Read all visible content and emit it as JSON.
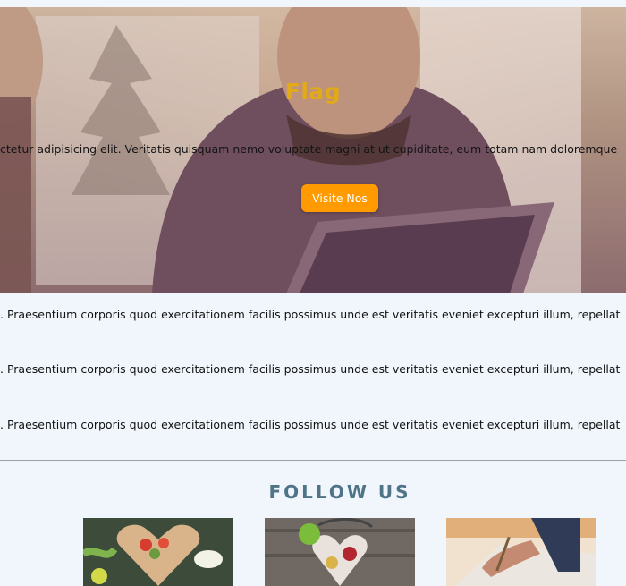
{
  "hero": {
    "title": "Flag",
    "subtitle": "ctetur adipisicing elit. Veritatis quisquam nemo voluptate magni at ut cupiditate, eum totam nam doloremque",
    "button_label": "Visite Nos"
  },
  "text_lines": [
    ". Praesentium corporis quod exercitationem facilis possimus unde est veritatis eveniet excepturi illum, repellat",
    ". Praesentium corporis quod exercitationem facilis possimus unde est veritatis eveniet excepturi illum, repellat",
    ". Praesentium corporis quod exercitationem facilis possimus unde est veritatis eveniet excepturi illum, repellat"
  ],
  "follow": {
    "title": "FOLLOW US",
    "images": [
      {
        "label": "salad-heart-image"
      },
      {
        "label": "stethoscope-heart-image"
      },
      {
        "label": "writing-notes-image"
      }
    ]
  }
}
